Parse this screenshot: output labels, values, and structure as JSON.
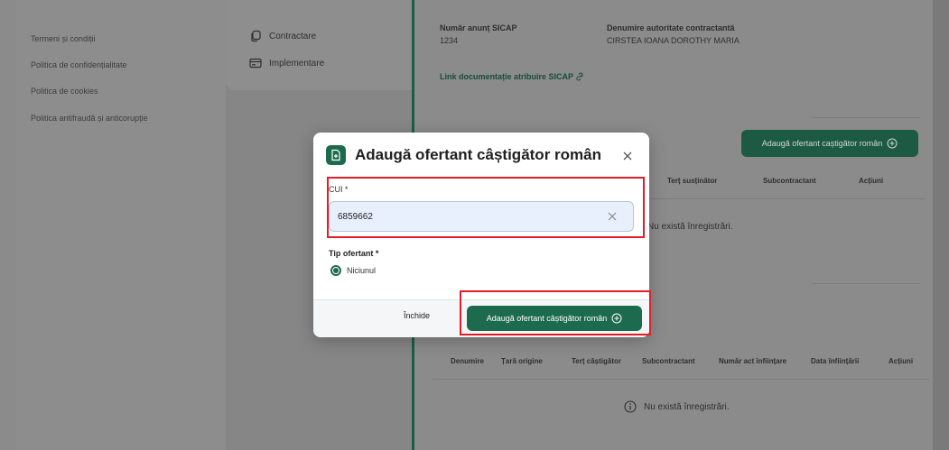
{
  "footer_links": [
    "Termeni și condiții",
    "Politica de confidențialitate",
    "Politica de cookies",
    "Politica antifraudă și anticorupție"
  ],
  "side_nav": [
    {
      "label": "Contractare",
      "icon": "copy-icon"
    },
    {
      "label": "Implementare",
      "icon": "credit-card-icon"
    }
  ],
  "notice": {
    "sicap_label": "Număr anunț SICAP",
    "sicap_value": "1234",
    "authority_label": "Denumire autoritate contractantă",
    "authority_value": "CIRSTEA IOANA DOROTHY MARIA",
    "doc_link": "Link documentație atribuire SICAP"
  },
  "bg_add_button": "Adaugă ofertant caștigător român",
  "table1": {
    "headers": [
      "Terț susținător",
      "Subcontractant",
      "Acțiuni"
    ],
    "empty": "Nu există înregistrări."
  },
  "table2": {
    "headers": [
      "Denumire",
      "Țară origine",
      "Terț câștigător",
      "Subcontractant",
      "Număr act înființare",
      "Data înființării",
      "Acțiuni"
    ],
    "empty": "Nu există înregistrări."
  },
  "modal": {
    "title": "Adaugă ofertant câștigător român",
    "cui_label": "CUI *",
    "cui_value": "6859662",
    "tip_label": "Tip ofertant *",
    "radio_option": "Niciunul",
    "close_label": "Închide",
    "add_label": "Adaugă ofertant câștigător român"
  },
  "colors": {
    "accent": "#1d6b4e",
    "highlight": "#e01e2a"
  }
}
